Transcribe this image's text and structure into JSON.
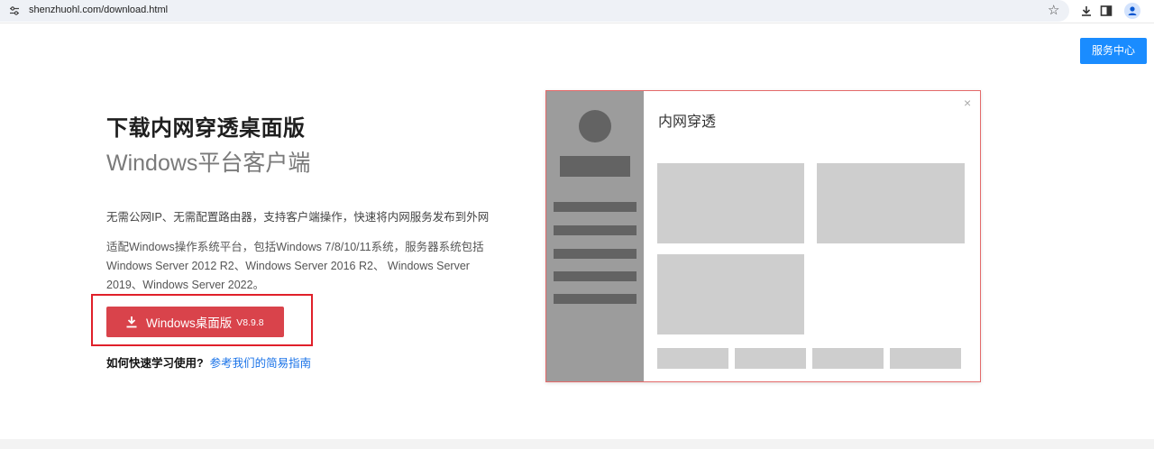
{
  "browser": {
    "url": "shenzhuohl.com/download.html",
    "icons": [
      "tune-icon",
      "star-icon",
      "download-icon",
      "side-panel-icon",
      "profile-icon"
    ]
  },
  "header": {
    "service_label": "服务中心"
  },
  "main": {
    "title": "下载内网穿透桌面版",
    "subtitle": "Windows平台客户端",
    "desc1": "无需公网IP、无需配置路由器，支持客户端操作，快速将内网服务发布到外网",
    "desc2": "适配Windows操作系统平台，包括Windows 7/8/10/11系统，服务器系统包括Windows Server 2012 R2、Windows Server 2016 R2、 Windows Server 2019、Windows Server 2022。",
    "download": {
      "label": "Windows桌面版",
      "version": "V8.9.8"
    },
    "howto_question": "如何快速学习使用?",
    "howto_link": "参考我们的简易指南"
  },
  "illustration": {
    "title": "内网穿透",
    "close": "×"
  },
  "colors": {
    "accent_blue": "#1a8cff",
    "download_red": "#d9434b",
    "highlight_red": "#e0202a",
    "link_blue": "#1a73e8"
  }
}
